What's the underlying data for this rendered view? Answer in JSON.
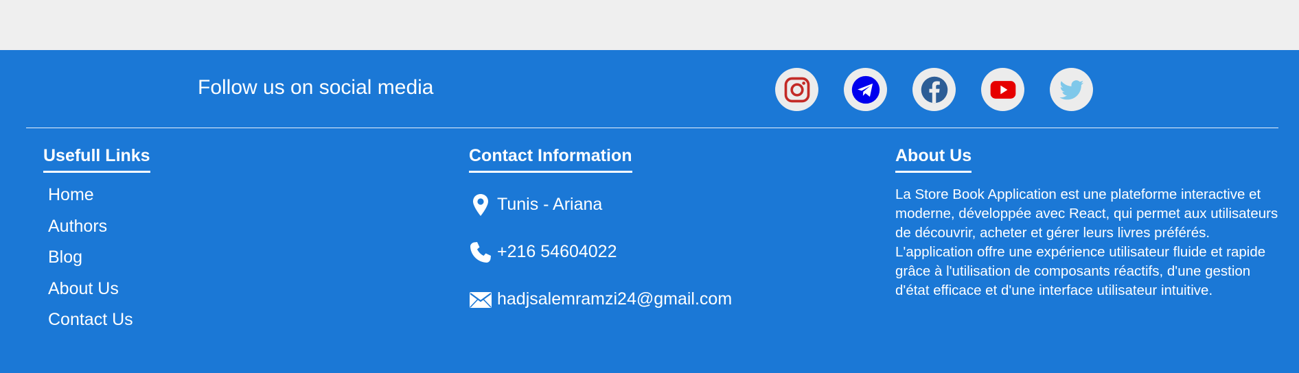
{
  "follow_title": "Follow us on social media",
  "social": [
    {
      "name": "instagram",
      "icon": "instagram-icon",
      "color": "#c32a26"
    },
    {
      "name": "telegram",
      "icon": "telegram-icon",
      "color": "#0000ee"
    },
    {
      "name": "facebook",
      "icon": "facebook-icon",
      "color": "#2c5d96"
    },
    {
      "name": "youtube",
      "icon": "youtube-icon",
      "color": "#e60000"
    },
    {
      "name": "twitter",
      "icon": "twitter-icon",
      "color": "#7fc8ea"
    }
  ],
  "links": {
    "heading": "Usefull Links",
    "items": [
      "Home",
      "Authors",
      "Blog",
      "About Us",
      "Contact Us"
    ]
  },
  "contact": {
    "heading": "Contact Information",
    "location": "Tunis - Ariana",
    "phone": "+216 54604022",
    "email": "hadjsalemramzi24@gmail.com",
    "icons": [
      "map-pin-icon",
      "phone-icon",
      "envelope-icon"
    ]
  },
  "about": {
    "heading": "About Us",
    "text": "La Store Book Application est une plateforme interactive et moderne, développée avec React, qui permet aux utilisateurs de découvrir, acheter et gérer leurs livres préférés. L'application offre une expérience utilisateur fluide et rapide grâce à l'utilisation de composants réactifs, d'une gestion d'état efficace et d'une interface utilisateur intuitive."
  },
  "colors": {
    "footer_bg": "#1b78d6",
    "page_bg": "#efefef",
    "text": "#ffffff"
  }
}
